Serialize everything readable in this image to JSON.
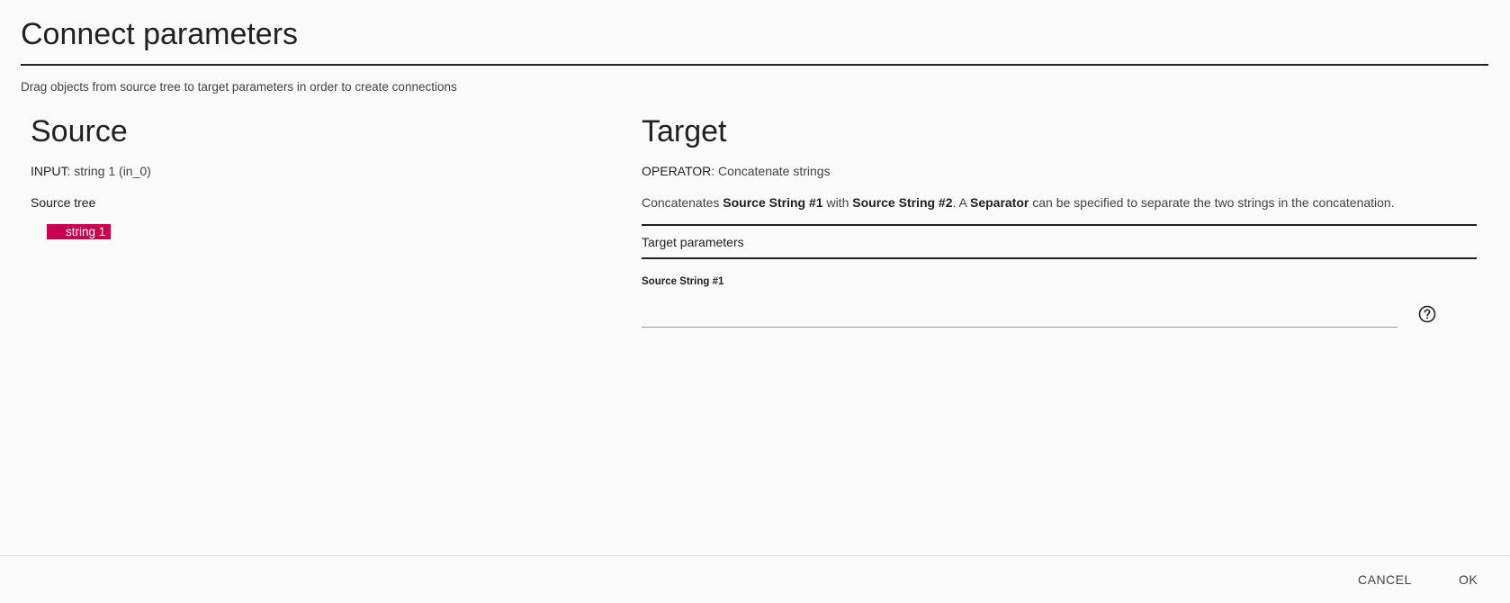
{
  "dialog": {
    "title": "Connect parameters",
    "instructions": "Drag objects from source tree to target parameters in order to create connections"
  },
  "source": {
    "heading": "Source",
    "input_key": "INPUT",
    "input_value": ": string 1 (in_0)",
    "tree_label": "Source tree",
    "tree_items": [
      {
        "label": "string 1",
        "color": "#c8004f"
      }
    ]
  },
  "target": {
    "heading": "Target",
    "operator_key": "OPERATOR",
    "operator_value": ": Concatenate strings",
    "description": {
      "p1": "Concatenates ",
      "b1": "Source String #1",
      "p2": " with ",
      "b2": "Source String #2",
      "p3": ". A ",
      "b3": "Separator",
      "p4": " can be specified to separate the two strings in the concatenation."
    },
    "params_label": "Target parameters",
    "fields": [
      {
        "label": "Source String #1",
        "value": "",
        "help_icon": "help-circle-icon"
      }
    ]
  },
  "footer": {
    "cancel_label": "CANCEL",
    "ok_label": "OK"
  }
}
